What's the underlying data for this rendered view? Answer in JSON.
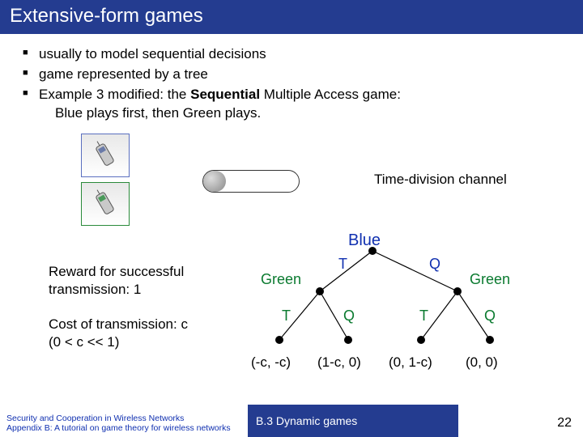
{
  "title": "Extensive-form games",
  "bullets": {
    "b1": "usually to model sequential decisions",
    "b2": "game represented by a tree",
    "b3a": "Example 3 modified: the ",
    "b3b": "Sequential",
    "b3c": " Multiple Access game:",
    "b3d": "Blue plays first, then Green plays."
  },
  "labels": {
    "td_channel": "Time-division channel",
    "reward1": "Reward for successful",
    "reward2": "transmission: 1",
    "cost1": "Cost of transmission: c",
    "cost2": "(0 < c << 1)"
  },
  "tree": {
    "blue": "Blue",
    "green_l": "Green",
    "green_r": "Green",
    "T": "T",
    "Q": "Q",
    "p1": "(-c, -c)",
    "p2": "(1-c, 0)",
    "p3": "(0, 1-c)",
    "p4": "(0, 0)"
  },
  "footer": {
    "l1": "Security and Cooperation in Wireless Networks",
    "l2": "Appendix B: A tutorial on game theory for wireless networks",
    "section": "B.3 Dynamic games",
    "page": "22"
  }
}
